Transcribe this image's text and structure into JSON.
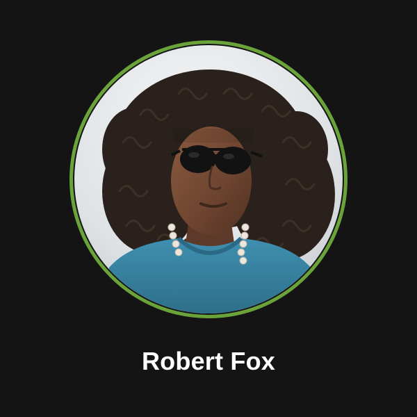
{
  "profile": {
    "name": "Robert Fox",
    "avatar_icon": "profile-photo",
    "ring_color": "#6aa33a",
    "background_color": "#141414"
  }
}
